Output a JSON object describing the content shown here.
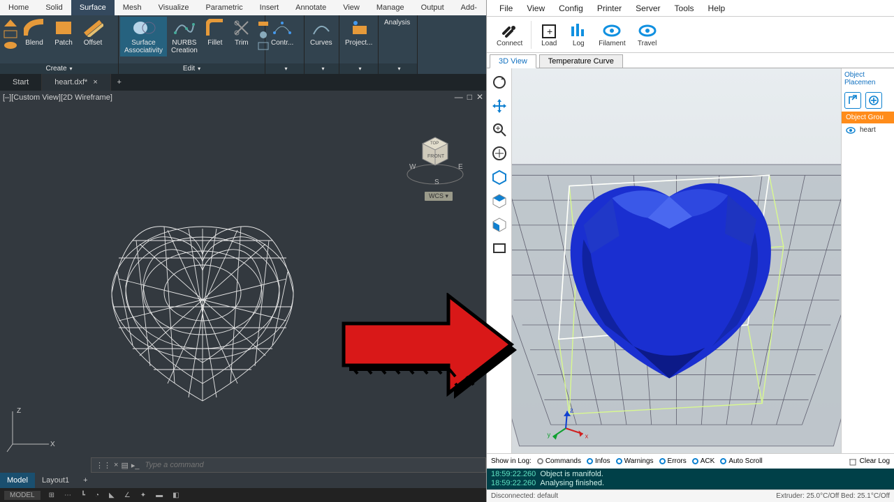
{
  "left": {
    "menu": [
      "Home",
      "Solid",
      "Surface",
      "Mesh",
      "Visualize",
      "Parametric",
      "Insert",
      "Annotate",
      "View",
      "Manage",
      "Output",
      "Add-ins"
    ],
    "menu_active": "Surface",
    "ribbon": {
      "create_label": "Create",
      "edit_label": "Edit",
      "curves_label": "Curves",
      "project_label": "Project...",
      "analysis_label": "Analysis",
      "blend": "Blend",
      "patch": "Patch",
      "offset": "Offset",
      "surf_assoc1": "Surface",
      "surf_assoc2": "Associativity",
      "nurbs1": "NURBS",
      "nurbs2": "Creation",
      "fillet": "Fillet",
      "trim": "Trim",
      "contr": "Contr..."
    },
    "tabs": {
      "start": "Start",
      "file": "heart.dxf*"
    },
    "view_title": "[–][Custom View][2D Wireframe]",
    "wcs": "WCS",
    "navcube_top": "TOP",
    "navcube_front": "FRONT",
    "compass": {
      "w": "W",
      "e": "E",
      "s": "S"
    },
    "cmd_placeholder": "Type a command",
    "layouts": {
      "model": "Model",
      "layout1": "Layout1"
    },
    "axis": {
      "z": "Z",
      "x": "X"
    },
    "status_model": "MODEL"
  },
  "right": {
    "menu": [
      "File",
      "View",
      "Config",
      "Printer",
      "Server",
      "Tools",
      "Help"
    ],
    "toolbar": {
      "connect": "Connect",
      "load": "Load",
      "log": "Log",
      "filament": "Filament",
      "travel": "Travel"
    },
    "tabs": {
      "view3d": "3D View",
      "temp": "Temperature Curve"
    },
    "side": {
      "placement": "Object Placemen",
      "group": "Object Grou",
      "obj": "heart"
    },
    "axis": {
      "x": "x",
      "y": "y",
      "z": "z"
    },
    "log": {
      "show": "Show in Log:",
      "commands": "Commands",
      "infos": "Infos",
      "warnings": "Warnings",
      "errors": "Errors",
      "ack": "ACK",
      "autoscroll": "Auto Scroll",
      "clear": "Clear Log"
    },
    "console": {
      "ts1": "18:59:22.260",
      "l1": "Object is manifold.",
      "ts2": "18:59:22.260",
      "l2": "Analysing finished."
    },
    "status": {
      "left": "Disconnected: default",
      "right": "Extruder: 25.0°C/Off  Bed: 25.1°C/Off"
    }
  }
}
